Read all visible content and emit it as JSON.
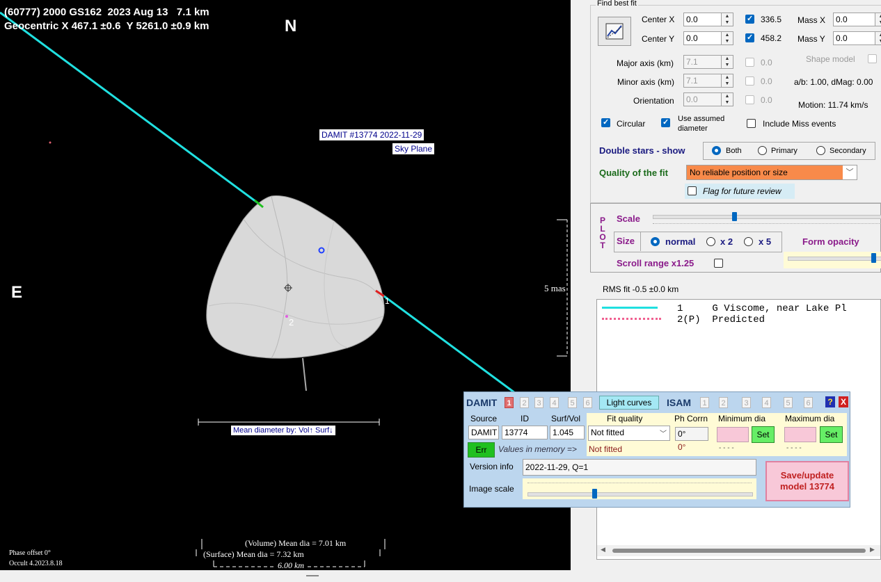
{
  "plot": {
    "title_line1": "(60777) 2000 GS162  2023 Aug 13   7.1 km",
    "title_line2": "Geocentric X 467.1 ±0.6  Y 5261.0 ±0.9 km",
    "north": "N",
    "east": "E",
    "model_label": "DAMIT #13774 2022-11-29",
    "sky_plane": "Sky Plane",
    "chord1": "1",
    "chord2": "2",
    "scale_mas": "5 mas",
    "mean_dia_by": "Mean diameter by: Vol↑ Surf↓",
    "vol_mean": "(Volume) Mean dia = 7.01 km",
    "surf_mean": "(Surface) Mean dia = 7.32 km",
    "km_scale": "6.00 km",
    "phase_offset": "Phase offset 0°",
    "version": "Occult 4.2023.8.18"
  },
  "bestfit": {
    "group_title": "Find best fit",
    "center_x_label": "Center X",
    "center_x": "0.0",
    "center_y_label": "Center Y",
    "center_y": "0.0",
    "center_x_fit": "336.5",
    "center_y_fit": "458.2",
    "mass_x_label": "Mass X",
    "mass_x": "0.0",
    "mass_y_label": "Mass Y",
    "mass_y": "0.0",
    "major_label": "Major axis (km)",
    "major": "7.1",
    "major_fit": "0.0",
    "minor_label": "Minor axis (km)",
    "minor": "7.1",
    "minor_fit": "0.0",
    "orient_label": "Orientation",
    "orient": "0.0",
    "orient_fit": "0.0",
    "shape_model": "Shape model",
    "ab_dmag": "a/b: 1.00, dMag: 0.00",
    "motion": "Motion: 11.74 km/s",
    "circular": "Circular",
    "use_assumed": "Use assumed diameter",
    "include_miss": "Include Miss events",
    "double_stars": "Double stars - show",
    "ds_both": "Both",
    "ds_primary": "Primary",
    "ds_secondary": "Secondary",
    "quality_label": "Quality of the fit",
    "quality_value": "No reliable position or size",
    "flag_review": "Flag for future review"
  },
  "plotctl": {
    "plot_letters": [
      "P",
      "L",
      "O",
      "T"
    ],
    "scale": "Scale",
    "size": "Size",
    "normal": "normal",
    "x2": "x 2",
    "x5": "x 5",
    "form_opacity": "Form opacity",
    "scroll_range": "Scroll range x1.25"
  },
  "rms": "RMS fit -0.5 ±0.0 km",
  "legend": {
    "row1": "1     G Viscome, near Lake Pl",
    "row2": "2(P)  Predicted"
  },
  "damit": {
    "title": "DAMIT",
    "nums": [
      "1",
      "2",
      "3",
      "4",
      "5",
      "6"
    ],
    "light_curves": "Light curves",
    "isam": "ISAM",
    "isam_nums": [
      "1",
      "2",
      "3",
      "4",
      "5",
      "6"
    ],
    "help": "?",
    "close": "X",
    "h_source": "Source",
    "h_id": "ID",
    "h_surfvol": "Surf/Vol",
    "h_fitq": "Fit quality",
    "h_phcorr": "Ph Corrn",
    "h_mindia": "Minimum dia",
    "h_maxdia": "Maximum dia",
    "source": "DAMIT",
    "id": "13774",
    "surfvol": "1.045",
    "fit_quality": "Not fitted",
    "phcorr": "0°",
    "set": "Set",
    "err": "Err",
    "values_mem": "Values in memory =>",
    "mem_fit": "Not fitted",
    "mem_ph": "0°",
    "mem_min": "- - - -",
    "mem_max": "- - - -",
    "version_label": "Version info",
    "version_value": "2022-11-29, Q=1",
    "image_scale": "Image scale",
    "save": "Save/update model 13774"
  }
}
